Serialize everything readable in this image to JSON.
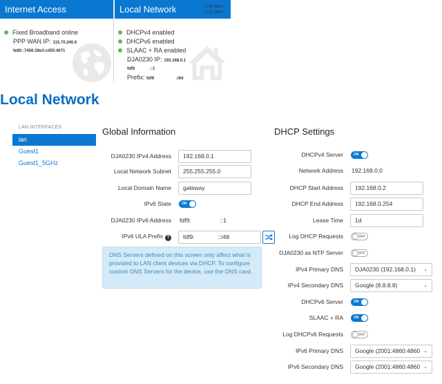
{
  "internet_card": {
    "title": "Internet Access",
    "status": "Fixed Broadband online",
    "wan_ip_label": "PPP WAN IP:",
    "wan_ip": "115.70.240.6",
    "wan_ipv6": "fe80::7456:28e3:c455:4071",
    "icon": "globe-icon"
  },
  "local_card": {
    "title": "Local Network",
    "rate_up": "6.64 Mb/s ↑",
    "rate_down": "8.21 Mb/s ↓",
    "dhcpv4": "DHCPv4 enabled",
    "dhcpv6": "DHCPv6 enabled",
    "slaac": "SLAAC + RA enabled",
    "ip_label": "DJA0230 IP:",
    "ip_value": "192.168.0.1",
    "ipv6_a": "fdf9",
    "ipv6_b": "::1",
    "prefix_label": "Prefix:",
    "prefix_a": "fdf9",
    "prefix_b": ":/64",
    "icon": "house-icon"
  },
  "page": {
    "title": "Local Network"
  },
  "sidebar": {
    "heading": "LAN INTERFACES",
    "items": [
      {
        "label": "lan",
        "active": true
      },
      {
        "label": "Guest1",
        "active": false
      },
      {
        "label": "Guest1_5GHz",
        "active": false
      }
    ]
  },
  "global": {
    "title": "Global Information",
    "ipv4_label": "DJA0230 IPv4 Address",
    "ipv4_value": "192.168.0.1",
    "subnet_label": "Local Network Subnet",
    "subnet_value": "255.255.255.0",
    "domain_label": "Local Domain Name",
    "domain_value": "gateway",
    "ipv6_state_label": "IPv6 State",
    "ipv6_state": "ON",
    "ipv6_addr_label": "DJA0230 IPv6 Address",
    "ipv6_addr_a": "fdf9:",
    "ipv6_addr_b": "::1",
    "ula_label": "IPv6 ULA Prefix",
    "ula_a": "fdf9:",
    "ula_b": "::/48",
    "info": "DNS Servers defined on this screen only affect what is provided to LAN client devices via DHCP. To configure custom DNS Servers for the device, use the DNS card."
  },
  "dhcp": {
    "title": "DHCP Settings",
    "dhcpv4_server_label": "DHCPv4 Server",
    "dhcpv4_server": "ON",
    "network_address_label": "Network Address",
    "network_address": "192.168.0.0",
    "start_label": "DHCP Start Address",
    "start_value": "192.168.0.2",
    "end_label": "DHCP End Address",
    "end_value": "192.168.0.254",
    "lease_label": "Lease Time",
    "lease_value": "1d",
    "log_dhcp_label": "Log DHCP Requests",
    "log_dhcp": "OFF",
    "ntp_label": "DJA0230 as NTP Server",
    "ntp": "OFF",
    "ipv4_primary_label": "IPv4 Primary DNS",
    "ipv4_primary": "DJA0230 (192.168.0.1)",
    "ipv4_secondary_label": "IPv4 Secondary DNS",
    "ipv4_secondary": "Google (8.8.8.8)",
    "dhcpv6_server_label": "DHCPv6 Server",
    "dhcpv6_server": "ON",
    "slaac_label": "SLAAC + RA",
    "slaac": "ON",
    "log_dhcpv6_label": "Log DHCPv6 Requests",
    "log_dhcpv6": "OFF",
    "ipv6_primary_label": "IPv6 Primary DNS",
    "ipv6_primary": "Google (2001:4860:4860",
    "ipv6_secondary_label": "IPv6 Secondary DNS",
    "ipv6_secondary": "Google (2001:4860:4860"
  },
  "colors": {
    "accent": "#0a78d1",
    "success": "#5cb85c",
    "info_bg": "#d4eaf7"
  }
}
